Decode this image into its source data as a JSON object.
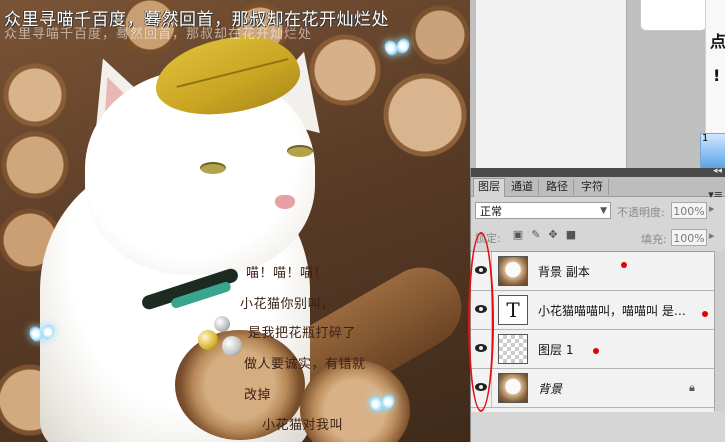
{
  "overlay": {
    "poem_line": "众里寻喵千百度，蓦然回首，那叔却在花开灿烂处",
    "poem_shadow": "众里寻喵千百度，蓦然回首，那叔却在花开灿烂处",
    "meow_lines": [
      "喵！喵！喵！",
      "小花猫你别叫，",
      "是我把花瓶打碎了",
      "做人要诚实，有错就",
      "改掉",
      "小花猫对我叫"
    ]
  },
  "document": {
    "text1": "点",
    "text2": "!",
    "thumb_label": "1"
  },
  "layers_panel": {
    "tabs": [
      "图层",
      "通道",
      "路径",
      "字符"
    ],
    "active_tab": "图层",
    "blend_mode": "正常",
    "opacity_label": "不透明度:",
    "opacity_value": "100%",
    "lock_label": "锁定:",
    "fill_label": "填充:",
    "fill_value": "100%",
    "layers": [
      {
        "name": "背景 副本",
        "thumb": "photo",
        "visible": true,
        "locked": false
      },
      {
        "name": "小花猫喵喵叫，喵喵叫  是…",
        "thumb": "text",
        "thumb_glyph": "T",
        "visible": true,
        "locked": false
      },
      {
        "name": "图层 1",
        "thumb": "transparent",
        "visible": true,
        "locked": false
      },
      {
        "name": "背景",
        "thumb": "photo",
        "visible": true,
        "locked": true
      }
    ]
  },
  "colors": {
    "annotation_red": "#e01010",
    "panel_bg": "#d6d6d6"
  },
  "icons": [
    "eye-icon",
    "lock-icon",
    "brush-lock-icon",
    "move-lock-icon",
    "lock-all-icon",
    "panel-menu-icon",
    "dropdown-arrow-icon",
    "butterfly-icon"
  ]
}
